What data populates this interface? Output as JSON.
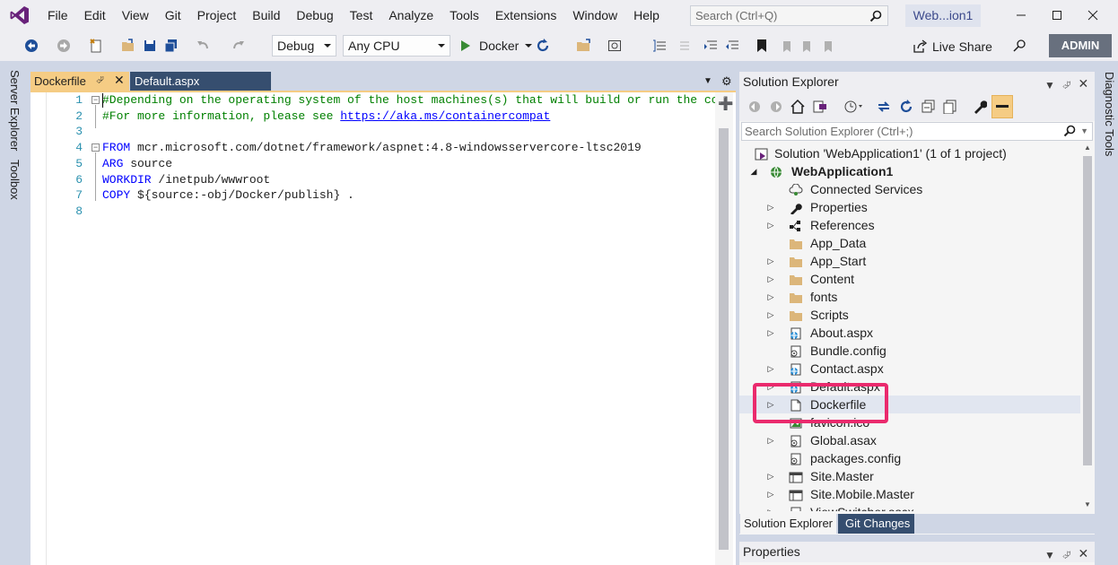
{
  "menu": {
    "items": [
      "File",
      "Edit",
      "View",
      "Git",
      "Project",
      "Build",
      "Debug",
      "Test",
      "Analyze",
      "Tools",
      "Extensions",
      "Window",
      "Help"
    ],
    "search_placeholder": "Search (Ctrl+Q)",
    "solution_badge": "Web...ion1"
  },
  "toolbar": {
    "config": "Debug",
    "platform": "Any CPU",
    "run_target": "Docker",
    "live_share": "Live Share",
    "account": "ADMIN"
  },
  "left_rail": {
    "server_explorer": "Server Explorer",
    "toolbox": "Toolbox"
  },
  "editor": {
    "tabs": [
      {
        "label": "Dockerfile",
        "active": true
      },
      {
        "label": "Default.aspx",
        "active": false
      }
    ],
    "lines": [
      {
        "num": "1",
        "text": "#Depending on the operating system of the host machines(s) that will build or run the co"
      },
      {
        "num": "2",
        "prefix": "#For more information, please see ",
        "link": "https://aka.ms/containercompat"
      },
      {
        "num": "3",
        "text": ""
      },
      {
        "num": "4",
        "keyword": "FROM",
        "rest": " mcr.microsoft.com/dotnet/framework/aspnet:4.8-windowsservercore-ltsc2019"
      },
      {
        "num": "5",
        "keyword": "ARG",
        "rest": " source"
      },
      {
        "num": "6",
        "keyword": "WORKDIR",
        "rest": " /inetpub/wwwroot"
      },
      {
        "num": "7",
        "keyword": "COPY",
        "rest": " ${source:-obj/Docker/publish} ."
      },
      {
        "num": "8",
        "text": ""
      }
    ]
  },
  "solution_explorer": {
    "title": "Solution Explorer",
    "search_placeholder": "Search Solution Explorer (Ctrl+;)",
    "solution_label": "Solution 'WebApplication1' (1 of 1 project)",
    "project_label": "WebApplication1",
    "items": [
      {
        "label": "Connected Services",
        "icon": "connected-services-icon",
        "expandable": false
      },
      {
        "label": "Properties",
        "icon": "wrench-icon",
        "expandable": true
      },
      {
        "label": "References",
        "icon": "references-icon",
        "expandable": true
      },
      {
        "label": "App_Data",
        "icon": "folder-icon",
        "expandable": false
      },
      {
        "label": "App_Start",
        "icon": "folder-icon",
        "expandable": true
      },
      {
        "label": "Content",
        "icon": "folder-icon",
        "expandable": true
      },
      {
        "label": "fonts",
        "icon": "folder-icon",
        "expandable": true
      },
      {
        "label": "Scripts",
        "icon": "folder-icon",
        "expandable": true
      },
      {
        "label": "About.aspx",
        "icon": "web-file-icon",
        "expandable": true
      },
      {
        "label": "Bundle.config",
        "icon": "config-icon",
        "expandable": false
      },
      {
        "label": "Contact.aspx",
        "icon": "web-file-icon",
        "expandable": true
      },
      {
        "label": "Default.aspx",
        "icon": "web-file-icon",
        "expandable": true
      },
      {
        "label": "Dockerfile",
        "icon": "file-icon",
        "expandable": true
      },
      {
        "label": "favicon.ico",
        "icon": "image-icon",
        "expandable": false
      },
      {
        "label": "Global.asax",
        "icon": "config-icon",
        "expandable": true
      },
      {
        "label": "packages.config",
        "icon": "config-icon",
        "expandable": false
      },
      {
        "label": "Site.Master",
        "icon": "master-icon",
        "expandable": true
      },
      {
        "label": "Site.Mobile.Master",
        "icon": "master-icon",
        "expandable": true
      },
      {
        "label": "ViewSwitcher.ascx",
        "icon": "web-file-icon",
        "expandable": true
      }
    ],
    "bottom_tabs": [
      "Solution Explorer",
      "Git Changes"
    ]
  },
  "properties": {
    "title": "Properties"
  },
  "right_rail": {
    "diagnostic_tools": "Diagnostic Tools"
  },
  "colors": {
    "highlight": "#ea2a6d",
    "active_tab": "#f5cc84",
    "inactive_tab": "#364e6f",
    "comment": "#008000",
    "keyword": "#0000ff",
    "line_number": "#2b91af"
  }
}
